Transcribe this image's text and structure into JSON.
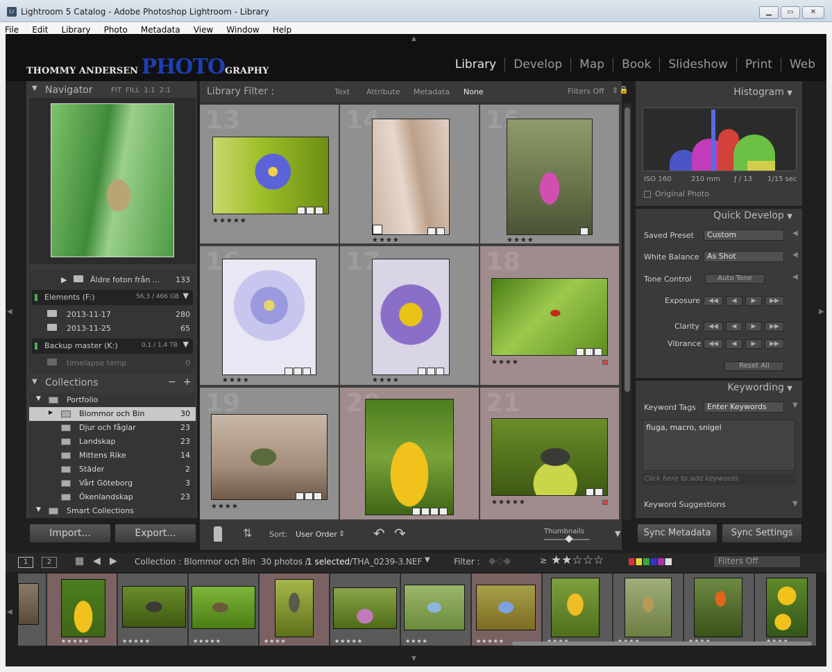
{
  "window": {
    "title": "Lightroom 5 Catalog - Adobe Photoshop Lightroom - Library",
    "app_icon": "Lr"
  },
  "menu": [
    "File",
    "Edit",
    "Library",
    "Photo",
    "Metadata",
    "View",
    "Window",
    "Help"
  ],
  "brand": {
    "part1": "THOMMY ANDERSEN ",
    "part2": "PHOTO",
    "part3": "GRAPHY"
  },
  "modules": [
    "Library",
    "Develop",
    "Map",
    "Book",
    "Slideshow",
    "Print",
    "Web"
  ],
  "navigator": {
    "title": "Navigator",
    "zoom": [
      "FIT",
      "FILL",
      "1:1",
      "2:1"
    ]
  },
  "folders": {
    "rows": [
      {
        "label": "Äldre foton från ...",
        "count": "133"
      },
      {
        "label": "2013-11-17",
        "count": "280"
      },
      {
        "label": "2013-11-25",
        "count": "65"
      },
      {
        "label": "timelapse temp",
        "count": "0"
      }
    ],
    "volumes": [
      {
        "name": "Elements (F:)",
        "size": "56,3 / 466 GB"
      },
      {
        "name": "Backup master (K:)",
        "size": "0,1 / 1,4 TB"
      }
    ]
  },
  "collections": {
    "title": "Collections",
    "portfolio": "Portfolio",
    "items": [
      {
        "label": "Blommor och Bin",
        "count": "30"
      },
      {
        "label": "Djur och fåglar",
        "count": "23"
      },
      {
        "label": "Landskap",
        "count": "23"
      },
      {
        "label": "Mittens Rike",
        "count": "14"
      },
      {
        "label": "Städer",
        "count": "2"
      },
      {
        "label": "Vårt Göteborg",
        "count": "3"
      },
      {
        "label": "Ökenlandskap",
        "count": "23"
      }
    ],
    "smart": "Smart Collections"
  },
  "buttons": {
    "import": "Import...",
    "export": "Export..."
  },
  "filter": {
    "label": "Library Filter :",
    "tabs": [
      "Text",
      "Attribute",
      "Metadata",
      "None"
    ],
    "state": "Filters Off"
  },
  "grid": {
    "cells": [
      {
        "num": "13",
        "stars": "★★★★★"
      },
      {
        "num": "14",
        "stars": "★★★★"
      },
      {
        "num": "15",
        "stars": "★★★★"
      },
      {
        "num": "16",
        "stars": "★★★★"
      },
      {
        "num": "17",
        "stars": "★★★★"
      },
      {
        "num": "18",
        "stars": "★★★★"
      },
      {
        "num": "19",
        "stars": "★★★★"
      },
      {
        "num": "20",
        "stars": ""
      },
      {
        "num": "21",
        "stars": "★★★★★"
      }
    ]
  },
  "toolbar": {
    "sort_label": "Sort:",
    "sort_value": "User Order",
    "thumbnails": "Thumbnails"
  },
  "histogram": {
    "title": "Histogram",
    "iso": "ISO 160",
    "focal": "210 mm",
    "aperture": "ƒ / 13",
    "shutter": "1/15 sec",
    "original": "Original Photo"
  },
  "quick_develop": {
    "title": "Quick Develop",
    "saved_preset": "Saved Preset",
    "saved_preset_value": "Custom",
    "white_balance": "White Balance",
    "white_balance_value": "As Shot",
    "tone_control": "Tone Control",
    "auto_tone": "Auto Tone",
    "exposure": "Exposure",
    "clarity": "Clarity",
    "vibrance": "Vibrance",
    "reset": "Reset All"
  },
  "keywording": {
    "title": "Keywording",
    "tags_label": "Keyword Tags",
    "tags_value": "Enter Keywords",
    "keywords": "fluga, macro, snigel",
    "add_placeholder": "Click here to add keywords",
    "suggestions": "Keyword Suggestions"
  },
  "sync": {
    "metadata": "Sync Metadata",
    "settings": "Sync Settings"
  },
  "filmbar": {
    "page1": "1",
    "page2": "2",
    "collection": "Collection : Blommor och Bin",
    "count": "30 photos /",
    "selected": "1 selected",
    "file": "/THA_0239-3.NEF",
    "filter": "Filter :",
    "ge": "≥",
    "filters_off": "Filters Off"
  },
  "filmstrip": [
    "★★★★★",
    "★★★★★",
    "★★★★★",
    "★★★★",
    "★★★★★",
    "★★★★",
    "★★★★★",
    "★★★★",
    "★★★★",
    "★★★★",
    "★★★★"
  ]
}
